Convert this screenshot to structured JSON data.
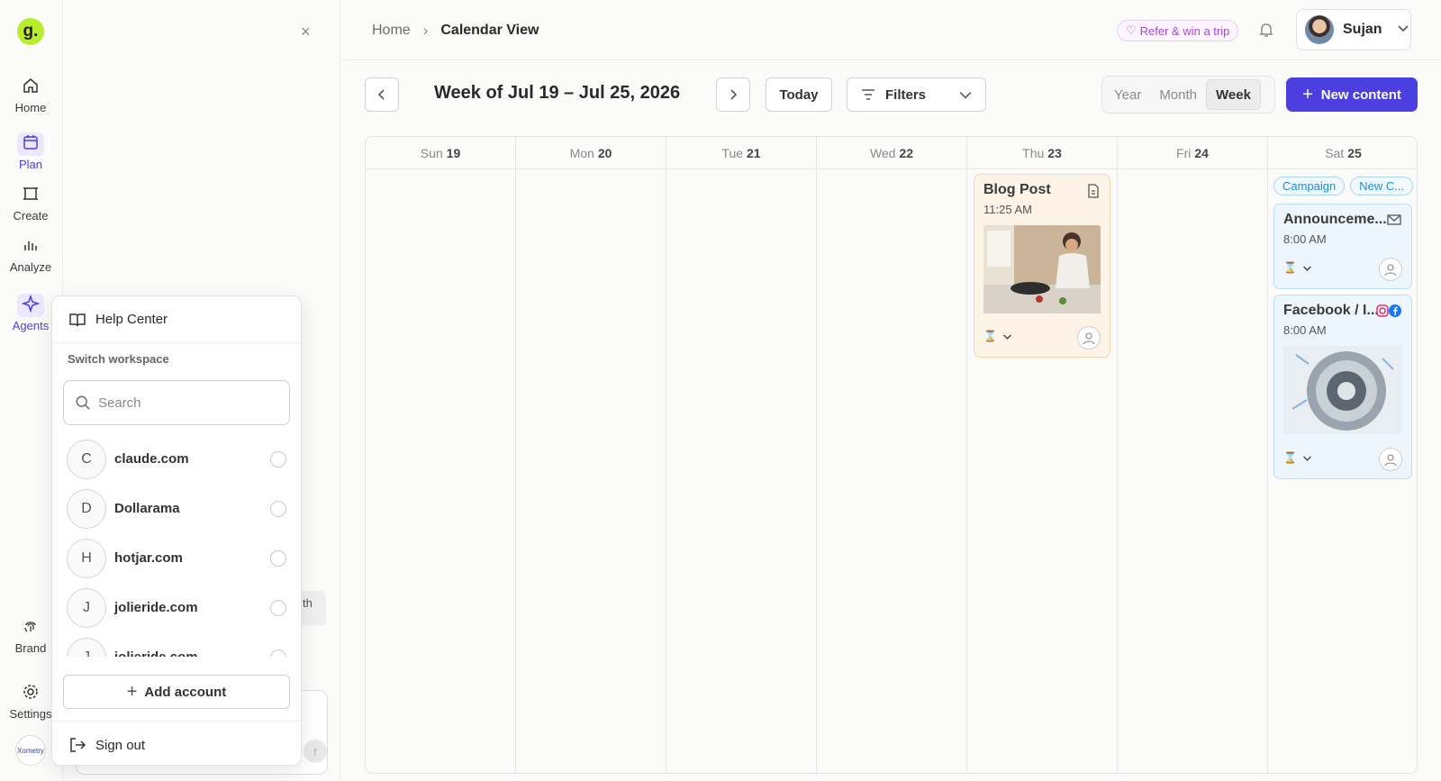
{
  "rail": {
    "items": [
      {
        "label": "Home",
        "icon": "home-icon"
      },
      {
        "label": "Plan",
        "icon": "calendar-icon"
      },
      {
        "label": "Create",
        "icon": "create-icon"
      },
      {
        "label": "Analyze",
        "icon": "bar-chart-icon"
      },
      {
        "label": "Agents",
        "icon": "sparkle-icon"
      },
      {
        "label": "Brand",
        "icon": "fingerprint-icon"
      },
      {
        "label": "Settings",
        "icon": "gear-icon"
      }
    ],
    "logo_text": "g.",
    "workspace_avatar_text": "Xometry"
  },
  "panel2": {
    "behind_text": "th"
  },
  "popover": {
    "help_center": "Help Center",
    "switch_workspace": "Switch workspace",
    "search_placeholder": "Search",
    "workspaces": [
      {
        "letter": "C",
        "name": "claude.com"
      },
      {
        "letter": "D",
        "name": "Dollarama"
      },
      {
        "letter": "H",
        "name": "hotjar.com"
      },
      {
        "letter": "J",
        "name": "jolieride.com"
      },
      {
        "letter": "J",
        "name": "jolieride.com"
      }
    ],
    "add_account": "Add account",
    "sign_out": "Sign out"
  },
  "header": {
    "breadcrumb_home": "Home",
    "breadcrumb_current": "Calendar View",
    "refer": "Refer & win a trip",
    "user_name": "Sujan"
  },
  "toolbar": {
    "week_title": "Week of Jul 19 – Jul 25, 2026",
    "today": "Today",
    "filters": "Filters",
    "views": [
      "Year",
      "Month",
      "Week"
    ],
    "selected_view": "Week",
    "new_content": "New content"
  },
  "calendar": {
    "days": [
      {
        "name": "Sun",
        "num": "19"
      },
      {
        "name": "Mon",
        "num": "20"
      },
      {
        "name": "Tue",
        "num": "21"
      },
      {
        "name": "Wed",
        "num": "22"
      },
      {
        "name": "Thu",
        "num": "23"
      },
      {
        "name": "Fri",
        "num": "24"
      },
      {
        "name": "Sat",
        "num": "25"
      }
    ],
    "events": {
      "blog": {
        "title": "Blog Post",
        "time": "11:25 AM"
      },
      "announcement": {
        "title": "Announceme...",
        "time": "8:00 AM"
      },
      "facebook": {
        "title": "Facebook / I...",
        "time": "8:00 AM"
      }
    },
    "sat_tags": [
      "Campaign",
      "New C..."
    ]
  },
  "colors": {
    "accent": "#4b3fe0",
    "logo": "#b9ec2e",
    "blog_card": "#fdf3e6",
    "social_card": "#eef6fd",
    "refer": "#a74ad6"
  }
}
